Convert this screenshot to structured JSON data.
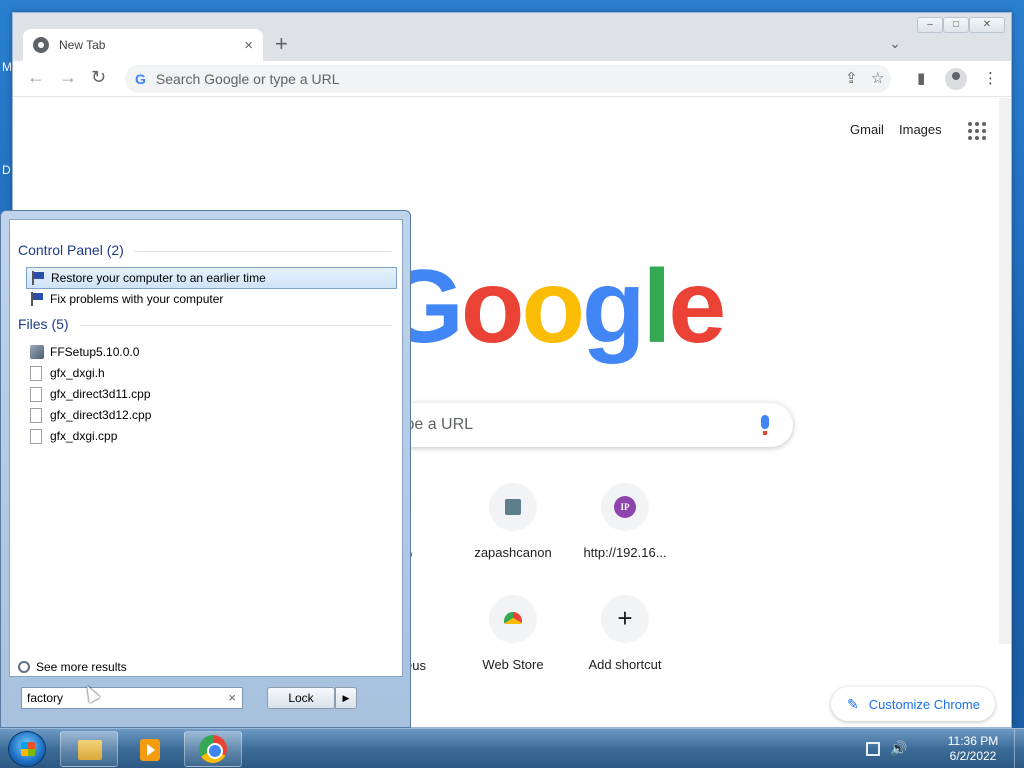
{
  "desktop": {
    "letters": [
      "M",
      "D"
    ]
  },
  "chrome": {
    "tab": {
      "title": "New Tab",
      "close": "×"
    },
    "new_tab": "+",
    "tab_search": "⌄",
    "window_controls": {
      "minimize": "–",
      "maximize": "□",
      "close": "✕"
    },
    "toolbar": {
      "back": "←",
      "forward": "→",
      "reload": "↻",
      "omnibox_placeholder": "Search Google or type a URL",
      "share": "⇪",
      "star": "☆",
      "side_panel": "▮",
      "menu": "⋮"
    },
    "ntp": {
      "gmail": "Gmail",
      "images": "Images",
      "logo": [
        "G",
        "o",
        "o",
        "g",
        "l",
        "e"
      ],
      "logo_colors": [
        "#4285f4",
        "#ea4335",
        "#fbbc05",
        "#4285f4",
        "#34a853",
        "#ea4335"
      ],
      "search_placeholder": "type a URL",
      "shortcuts_row1": [
        {
          "label": "zapashcanon"
        },
        {
          "label": "http://192.16...",
          "badge": "IP"
        }
      ],
      "shortcuts_row2": [
        {
          "label": "Web Store"
        },
        {
          "label": "Add shortcut",
          "glyph": "+"
        }
      ],
      "partial_labels": {
        "row1": "o",
        "row2": "eus"
      },
      "customize": "Customize Chrome"
    }
  },
  "start_menu": {
    "group_control_panel": "Control Panel (2)",
    "control_panel_items": [
      "Restore your computer to an earlier time",
      "Fix problems with your computer"
    ],
    "group_files": "Files (5)",
    "file_items": [
      "FFSetup5.10.0.0",
      "gfx_dxgi.h",
      "gfx_direct3d11.cpp",
      "gfx_direct3d12.cpp",
      "gfx_dxgi.cpp"
    ],
    "see_more": "See more results",
    "search_value": "factory",
    "search_clear": "×",
    "lock_label": "Lock",
    "lock_arrow": "▶"
  },
  "taskbar": {
    "clock_time": "11:36 PM",
    "clock_date": "6/2/2022",
    "volume": "🔊"
  }
}
